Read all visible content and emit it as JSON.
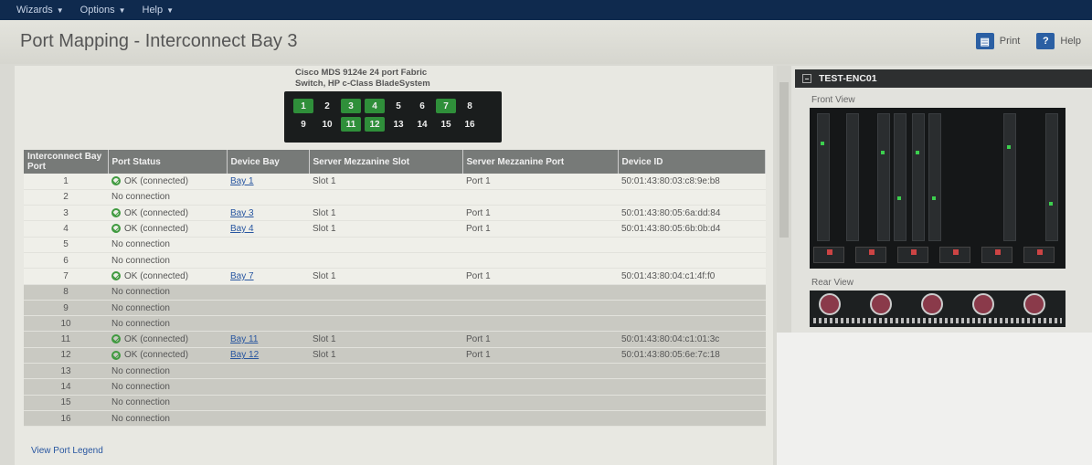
{
  "menu": [
    {
      "label": "Wizards"
    },
    {
      "label": "Options"
    },
    {
      "label": "Help"
    }
  ],
  "page_title": "Port Mapping - Interconnect Bay 3",
  "actions": {
    "print": "Print",
    "help": "Help"
  },
  "switch": {
    "caption_line1": "Cisco MDS 9124e 24 port Fabric",
    "caption_line2": "Switch, HP c-Class BladeSystem",
    "ports_top": [
      "1",
      "2",
      "3",
      "4",
      "5",
      "6",
      "7",
      "8"
    ],
    "ports_bottom": [
      "9",
      "10",
      "11",
      "12",
      "13",
      "14",
      "15",
      "16"
    ],
    "connected": [
      "1",
      "3",
      "4",
      "7",
      "11",
      "12"
    ]
  },
  "table": {
    "headers": [
      "Interconnect Bay Port",
      "Port Status",
      "Device Bay",
      "Server Mezzanine Slot",
      "Server Mezzanine Port",
      "Device ID"
    ],
    "rows": [
      {
        "port": "1",
        "status": "OK (connected)",
        "ok": true,
        "bay": "Bay 1",
        "slot": "Slot 1",
        "mport": "Port 1",
        "id": "50:01:43:80:03:c8:9e:b8"
      },
      {
        "port": "2",
        "status": "No connection",
        "ok": false,
        "bay": "",
        "slot": "",
        "mport": "",
        "id": ""
      },
      {
        "port": "3",
        "status": "OK (connected)",
        "ok": true,
        "bay": "Bay 3",
        "slot": "Slot 1",
        "mport": "Port 1",
        "id": "50:01:43:80:05:6a:dd:84"
      },
      {
        "port": "4",
        "status": "OK (connected)",
        "ok": true,
        "bay": "Bay 4",
        "slot": "Slot 1",
        "mport": "Port 1",
        "id": "50:01:43:80:05:6b:0b:d4"
      },
      {
        "port": "5",
        "status": "No connection",
        "ok": false,
        "bay": "",
        "slot": "",
        "mport": "",
        "id": ""
      },
      {
        "port": "6",
        "status": "No connection",
        "ok": false,
        "bay": "",
        "slot": "",
        "mport": "",
        "id": ""
      },
      {
        "port": "7",
        "status": "OK (connected)",
        "ok": true,
        "bay": "Bay 7",
        "slot": "Slot 1",
        "mport": "Port 1",
        "id": "50:01:43:80:04:c1:4f:f0"
      },
      {
        "port": "8",
        "status": "No connection",
        "ok": false,
        "bay": "",
        "slot": "",
        "mport": "",
        "id": ""
      },
      {
        "port": "9",
        "status": "No connection",
        "ok": false,
        "bay": "",
        "slot": "",
        "mport": "",
        "id": ""
      },
      {
        "port": "10",
        "status": "No connection",
        "ok": false,
        "bay": "",
        "slot": "",
        "mport": "",
        "id": ""
      },
      {
        "port": "11",
        "status": "OK (connected)",
        "ok": true,
        "bay": "Bay 11",
        "slot": "Slot 1",
        "mport": "Port 1",
        "id": "50:01:43:80:04:c1:01:3c"
      },
      {
        "port": "12",
        "status": "OK (connected)",
        "ok": true,
        "bay": "Bay 12",
        "slot": "Slot 1",
        "mport": "Port 1",
        "id": "50:01:43:80:05:6e:7c:18"
      },
      {
        "port": "13",
        "status": "No connection",
        "ok": false,
        "bay": "",
        "slot": "",
        "mport": "",
        "id": ""
      },
      {
        "port": "14",
        "status": "No connection",
        "ok": false,
        "bay": "",
        "slot": "",
        "mport": "",
        "id": ""
      },
      {
        "port": "15",
        "status": "No connection",
        "ok": false,
        "bay": "",
        "slot": "",
        "mport": "",
        "id": ""
      },
      {
        "port": "16",
        "status": "No connection",
        "ok": false,
        "bay": "",
        "slot": "",
        "mport": "",
        "id": ""
      }
    ]
  },
  "legend_link": "View Port Legend",
  "enclosure": {
    "name": "TEST-ENC01",
    "front_label": "Front View",
    "rear_label": "Rear View"
  },
  "colors": {
    "menubar": "#0f2a4e",
    "ok": "#3f9a3f",
    "port_on": "#2f8f3a",
    "link": "#2856a0"
  }
}
